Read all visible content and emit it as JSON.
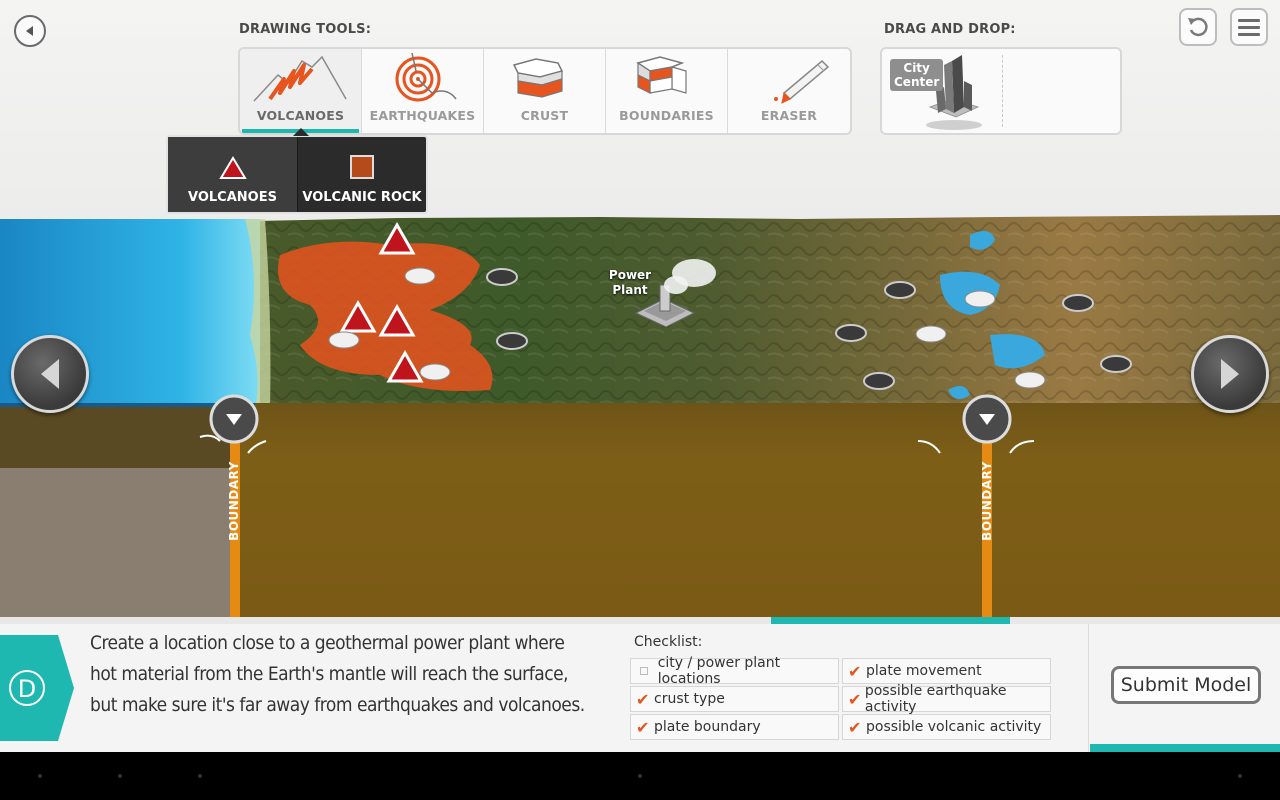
{
  "header": {
    "back_icon": "back-arrow-icon",
    "undo_icon": "undo-icon",
    "menu_icon": "menu-icon",
    "drawing_tools_label": "DRAWING TOOLS:",
    "drag_drop_label": "DRAG AND DROP:"
  },
  "tools": [
    {
      "label": "VOLCANOES",
      "icon": "volcano-icon",
      "active": true
    },
    {
      "label": "EARTHQUAKES",
      "icon": "earthquake-icon",
      "active": false
    },
    {
      "label": "CRUST",
      "icon": "crust-icon",
      "active": false
    },
    {
      "label": "BOUNDARIES",
      "icon": "boundaries-icon",
      "active": false
    },
    {
      "label": "ERASER",
      "icon": "eraser-icon",
      "active": false
    }
  ],
  "drag_drop": {
    "city_center_label": "City Center",
    "city_line1": "City",
    "city_line2": "Center"
  },
  "submenu": {
    "items": [
      {
        "label": "VOLCANOES",
        "icon": "triangle-icon",
        "selected": true
      },
      {
        "label": "VOLCANIC ROCK",
        "icon": "square-icon",
        "selected": false
      }
    ]
  },
  "map": {
    "power_plant_line1": "Power",
    "power_plant_line2": "Plant",
    "boundary_left": "BOUNDARY",
    "boundary_right": "BOUNDARY"
  },
  "progress": {
    "fraction": 0.19
  },
  "step": {
    "letter": "D"
  },
  "instructions": {
    "line1": "Create a location close to a geothermal power plant where",
    "line2": "hot material from the Earth's mantle will reach the surface,",
    "line3": "but make sure it's far away from earthquakes and volcanoes."
  },
  "checklist": {
    "title": "Checklist:",
    "items": [
      {
        "label": "city / power plant locations",
        "checked": false
      },
      {
        "label": "plate movement",
        "checked": true
      },
      {
        "label": "crust type",
        "checked": true
      },
      {
        "label": "possible earthquake activity",
        "checked": true
      },
      {
        "label": "plate boundary",
        "checked": true
      },
      {
        "label": "possible volcanic activity",
        "checked": true
      }
    ],
    "check_glyph": "✔"
  },
  "submit": {
    "label": "Submit Model"
  },
  "colors": {
    "accent": "#1fb8b0",
    "lava": "#e8541e",
    "volcano_red": "#c0141c"
  }
}
